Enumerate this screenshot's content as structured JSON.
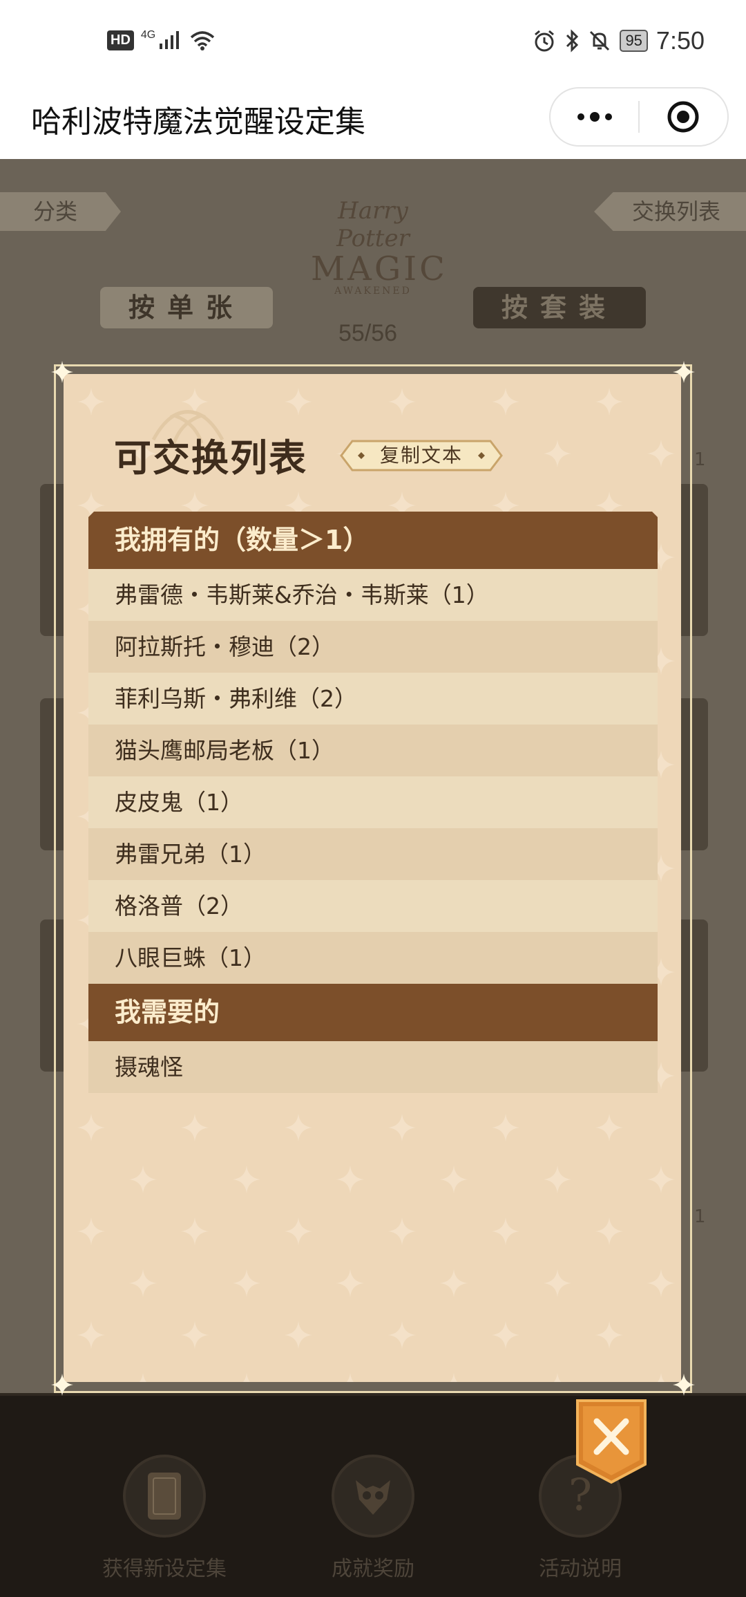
{
  "status_bar": {
    "hd": "HD",
    "network": "4G",
    "battery": "95",
    "time": "7:50"
  },
  "title_bar": {
    "title": "哈利波特魔法觉醒设定集"
  },
  "background": {
    "tag_left": "分类",
    "tag_right": "交换列表",
    "logo_line1": "Harry Potter",
    "logo_line2": "MAGIC",
    "logo_line3": "AWAKENED",
    "btn_single": "按单张",
    "btn_set": "按套装",
    "counter": "55/56",
    "side_num_1": "1",
    "side_num_2": "1"
  },
  "bottom_nav": {
    "items": [
      {
        "label": "获得新设定集",
        "icon": "card-icon"
      },
      {
        "label": "成就奖励",
        "icon": "owl-icon"
      },
      {
        "label": "活动说明",
        "icon": "question-icon"
      }
    ]
  },
  "modal": {
    "title": "可交换列表",
    "copy_label": "复制文本",
    "owned_header": "我拥有的（数量＞1）",
    "owned_items": [
      "弗雷德・韦斯莱&乔治・韦斯莱（1）",
      "阿拉斯托・穆迪（2）",
      "菲利乌斯・弗利维（2）",
      "猫头鹰邮局老板（1）",
      "皮皮鬼（1）",
      "弗雷兄弟（1）",
      "格洛普（2）",
      "八眼巨蛛（1）"
    ],
    "needed_header": "我需要的",
    "needed_items": [
      "摄魂怪"
    ],
    "close_icon": "close-x-icon"
  },
  "colors": {
    "modal_bg": "#eed7b8",
    "header_brown": "#7c4f2a",
    "row_light": "#ecdcbd",
    "row_dark": "#e4cfae",
    "close_orange": "#d9822b"
  }
}
